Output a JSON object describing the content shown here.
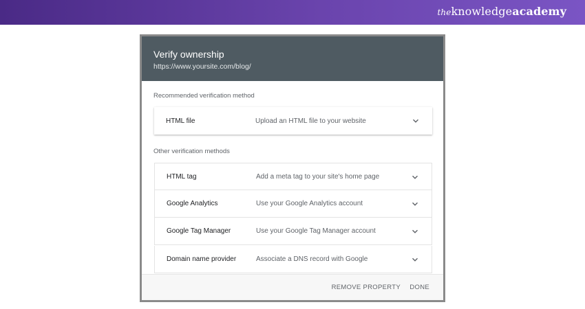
{
  "brand": {
    "prefix": "the",
    "middle": "knowledge",
    "suffix": "academy"
  },
  "dialog": {
    "title": "Verify ownership",
    "url": "https://www.yoursite.com/blog/",
    "recommended_label": "Recommended verification method",
    "other_label": "Other verification methods",
    "recommended": {
      "name": "HTML file",
      "description": "Upload an HTML file to your website"
    },
    "others": [
      {
        "name": "HTML tag",
        "description": "Add a meta tag to your site's home page"
      },
      {
        "name": "Google Analytics",
        "description": "Use your Google Analytics account"
      },
      {
        "name": "Google Tag Manager",
        "description": "Use your Google Tag Manager account"
      },
      {
        "name": "Domain name provider",
        "description": "Associate a DNS record with Google"
      }
    ],
    "footer": {
      "remove_label": "REMOVE PROPERTY",
      "done_label": "DONE"
    }
  },
  "colors": {
    "banner": "#5b3a9e",
    "header": "#4f5b62",
    "text_secondary": "#5f6368"
  },
  "icons": {
    "expand": "chevron-down-icon"
  }
}
